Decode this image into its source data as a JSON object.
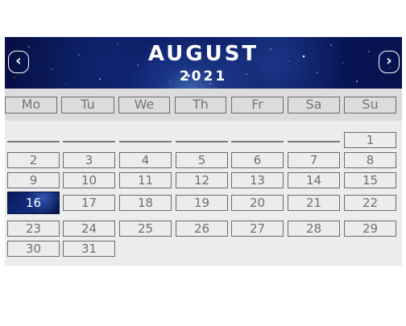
{
  "calendar": {
    "month": "AUGUST",
    "year": "2021",
    "prev_label": "‹",
    "next_label": "›",
    "weekdays": [
      "Mo",
      "Tu",
      "We",
      "Th",
      "Fr",
      "Sa",
      "Su"
    ],
    "leading_blank_days": 6,
    "days": [
      "1",
      "2",
      "3",
      "4",
      "5",
      "6",
      "7",
      "8",
      "9",
      "10",
      "11",
      "12",
      "13",
      "14",
      "15",
      "16",
      "17",
      "18",
      "19",
      "20",
      "21",
      "22",
      "23",
      "24",
      "25",
      "26",
      "27",
      "28",
      "29",
      "30",
      "31"
    ],
    "selected_day": "16",
    "colors": {
      "header_bg": "#0b1c63",
      "selected_bg": "#0f2a7a",
      "grid_bg": "#ececec",
      "weekday_bg": "#dcdcdc",
      "border": "#6b6b6b",
      "text": "#707070"
    }
  }
}
